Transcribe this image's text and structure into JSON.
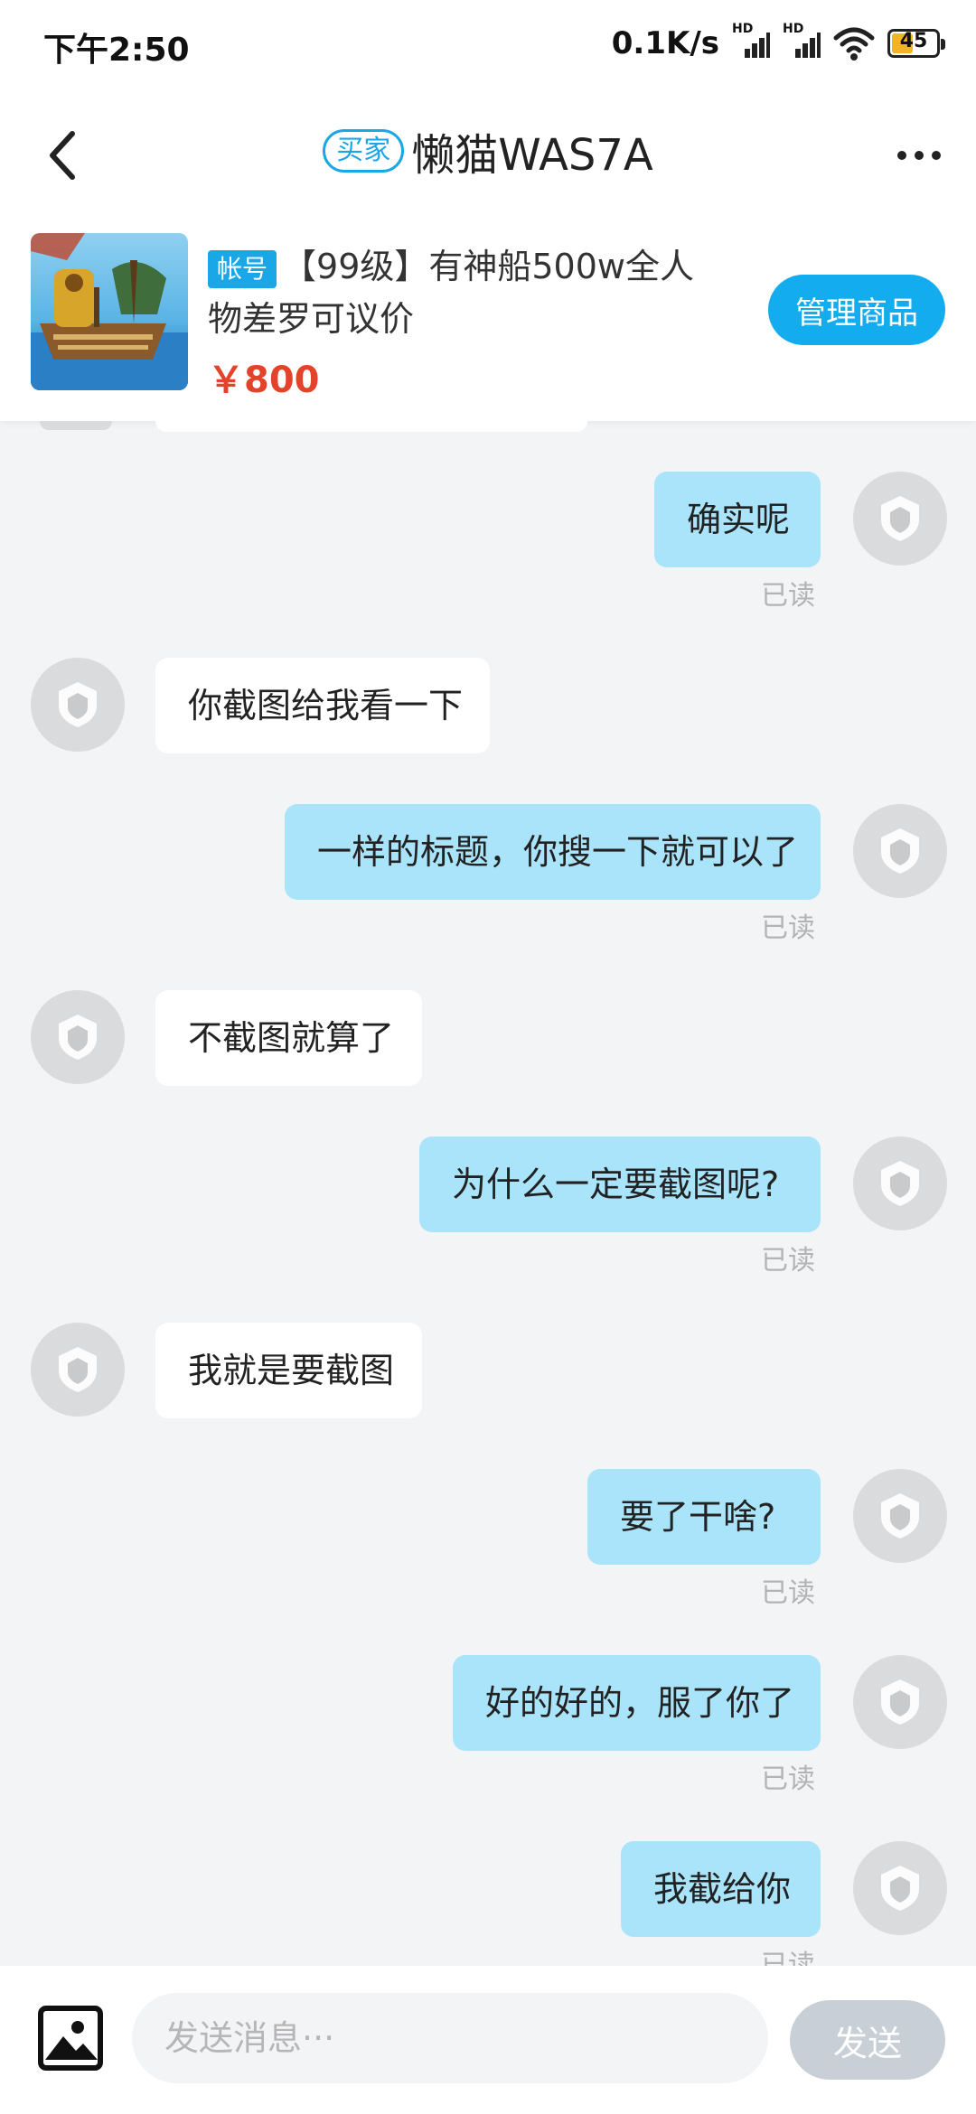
{
  "status_bar": {
    "time": "下午2:50",
    "net_speed": "0.1K/s",
    "signal_label": "HD",
    "battery": "45"
  },
  "header": {
    "role_tag": "买家",
    "title": "懒猫WAS7A",
    "back_icon": "chevron-left-icon",
    "more_icon": "more-icon"
  },
  "product": {
    "tag": "帐号",
    "title": "【99级】有神船500w全人物差罗可议价",
    "price": "￥800",
    "manage_label": "管理商品"
  },
  "messages": [
    {
      "from": "me",
      "text": "确实呢",
      "status": "已读"
    },
    {
      "from": "them",
      "text": "你截图给我看一下"
    },
    {
      "from": "me",
      "text": "一样的标题，你搜一下就可以了",
      "status": "已读"
    },
    {
      "from": "them",
      "text": "不截图就算了"
    },
    {
      "from": "me",
      "text": "为什么一定要截图呢?",
      "status": "已读"
    },
    {
      "from": "them",
      "text": "我就是要截图"
    },
    {
      "from": "me",
      "text": "要了干啥?",
      "status": "已读"
    },
    {
      "from": "me",
      "text": "好的好的，服了你了",
      "status": "已读"
    },
    {
      "from": "me",
      "text": "我截给你",
      "status": "已读"
    }
  ],
  "composer": {
    "placeholder": "发送消息···",
    "send_label": "发送",
    "image_icon": "image-icon"
  },
  "colors": {
    "accent": "#13acef",
    "my_bubble": "#a9e4fb",
    "price": "#e3432a",
    "background": "#f3f4f6"
  }
}
